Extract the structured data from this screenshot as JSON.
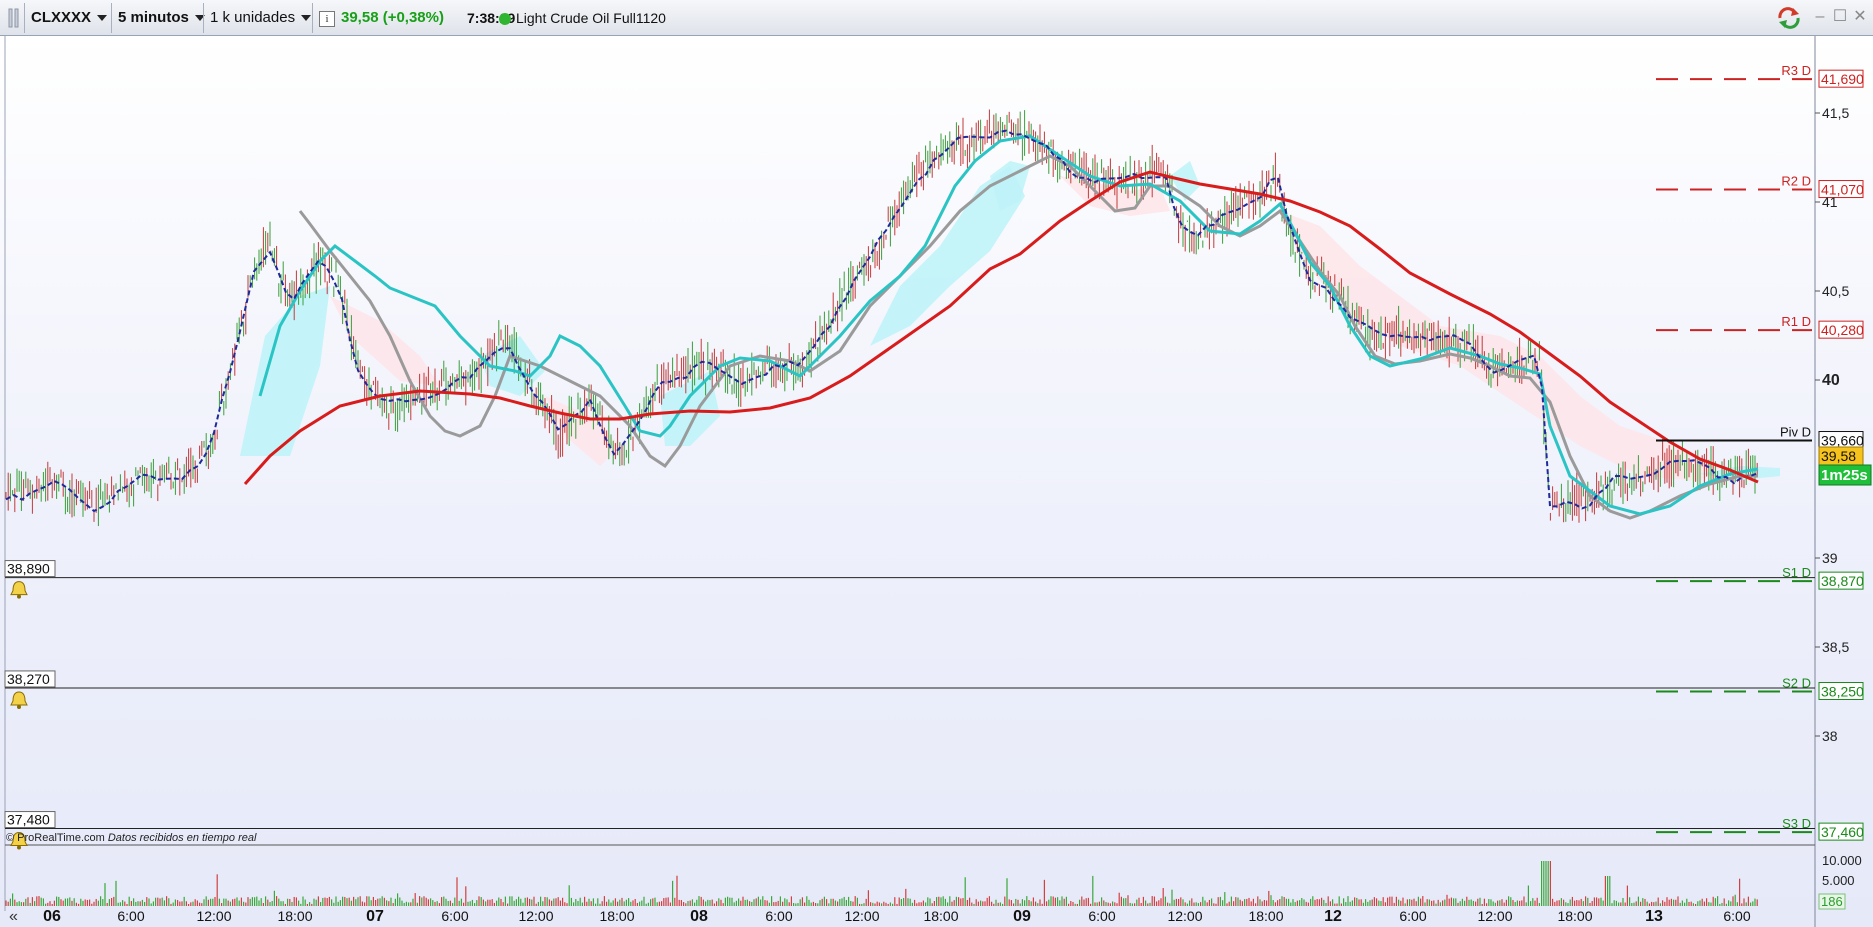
{
  "toolbar": {
    "symbol": "CLXXXX",
    "timeframe": "5 minutos",
    "units": "1 k unidades",
    "price_change": "39,58 (+0,38%)",
    "time": "7:38:29",
    "instrument": "Light Crude Oil Full1120",
    "colors": {
      "price_change": "#18a018",
      "status_dot": "#2fb52f"
    }
  },
  "chart": {
    "price_axis_labels": [
      "41,5",
      "41",
      "40,5",
      "40",
      "39",
      "38,5",
      "38"
    ],
    "price_axis_bold": "40",
    "time_axis_labels": [
      "06",
      "6:00",
      "12:00",
      "18:00",
      "07",
      "6:00",
      "12:00",
      "18:00",
      "08",
      "6:00",
      "12:00",
      "18:00",
      "09",
      "6:00",
      "12:00",
      "18:00",
      "12",
      "6:00",
      "12:00",
      "18:00",
      "13",
      "6:00"
    ],
    "time_axis_bold": [
      "06",
      "07",
      "08",
      "09",
      "12",
      "13"
    ],
    "pivots": [
      {
        "label": "R3 D",
        "value": "41,690",
        "color": "#cc2222"
      },
      {
        "label": "R2 D",
        "value": "41,070",
        "color": "#cc2222"
      },
      {
        "label": "R1 D",
        "value": "40,280",
        "color": "#cc2222"
      },
      {
        "label": "Piv D",
        "value": "39,660",
        "color": "#111111"
      },
      {
        "label": "S1 D",
        "value": "38,870",
        "color": "#1a8a1a"
      },
      {
        "label": "S2 D",
        "value": "38,250",
        "color": "#1a8a1a"
      },
      {
        "label": "S3 D",
        "value": "37,460",
        "color": "#1a8a1a"
      }
    ],
    "current_price": "39,58",
    "countdown": "1m25s",
    "alerts": [
      "38,890",
      "38,270",
      "37,480"
    ],
    "volume_axis_labels": [
      "10.000",
      "5.000"
    ],
    "volume_current": "186",
    "credit_site": "© ProRealTime.com",
    "credit_text": "Datos recibidos en tiempo real"
  }
}
